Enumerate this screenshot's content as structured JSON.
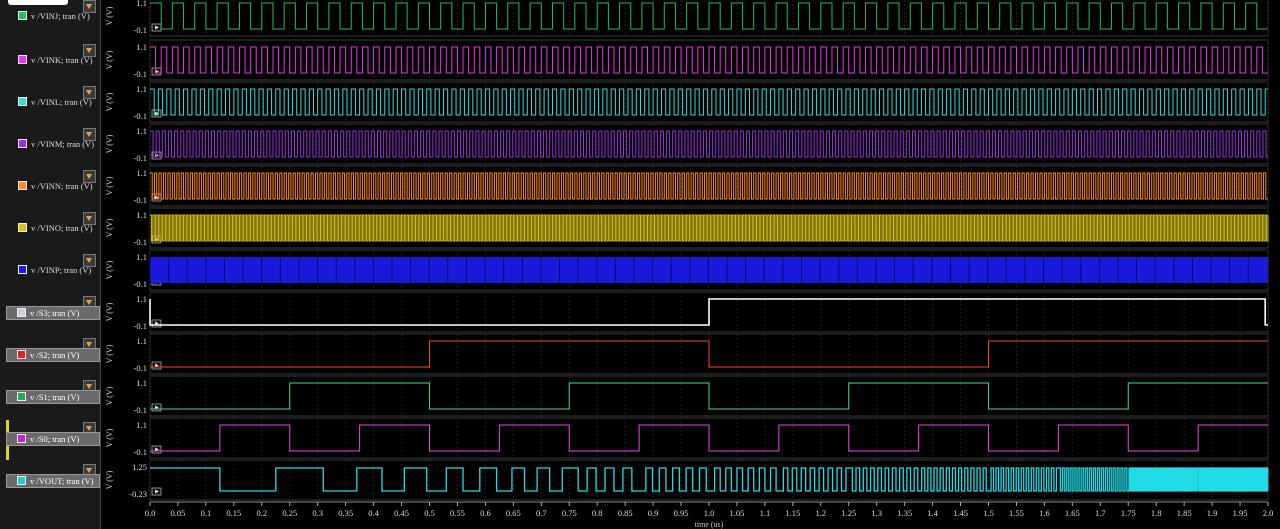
{
  "colors": {
    "background": "#000000",
    "panel": "#1a1a1a",
    "grid": "#2a2a2a"
  },
  "signals": [
    {
      "label": "v /VINJ; tran (V)",
      "color": "#1fbe5a",
      "boxed": false,
      "kind": "clock",
      "period": 0.04
    },
    {
      "label": "v /VINK; tran (V)",
      "color": "#ee33ee",
      "boxed": false,
      "kind": "clock",
      "period": 0.02
    },
    {
      "label": "v /VINL; tran (V)",
      "color": "#33dddd",
      "boxed": false,
      "kind": "clock",
      "period": 0.015
    },
    {
      "label": "v /VINM; tran (V)",
      "color": "#9a33dd",
      "boxed": false,
      "kind": "clock",
      "period": 0.011
    },
    {
      "label": "v /VINN; tran (V)",
      "color": "#ff8a1f",
      "boxed": false,
      "kind": "clock",
      "period": 0.008
    },
    {
      "label": "v /VINO; tran (V)",
      "color": "#d6c21a",
      "boxed": false,
      "kind": "clock",
      "period": 0.005
    },
    {
      "label": "v /VINP; tran (V)",
      "color": "#1a1adb",
      "boxed": false,
      "kind": "dense",
      "period": 0.002
    },
    {
      "label": "v /S3; tran (V)",
      "color": "#ffffff",
      "boxed": true,
      "swatch": "#c8d0e0",
      "kind": "step",
      "steps": [
        [
          0,
          0
        ],
        [
          0.005,
          0
        ],
        [
          1.0,
          1
        ],
        [
          1.99,
          1
        ],
        [
          1.995,
          0
        ]
      ]
    },
    {
      "label": "v /S2; tran (V)",
      "color": "#ff4422",
      "boxed": true,
      "swatch": "#dd2222",
      "kind": "clock",
      "period": 1.0,
      "phase": 0.5
    },
    {
      "label": "v /S1; tran (V)",
      "color": "#44dd77",
      "boxed": true,
      "swatch": "#22aa55",
      "kind": "clock",
      "period": 0.5,
      "phase": 0.25
    },
    {
      "label": "v /S0; tran (V)",
      "color": "#ee44ee",
      "boxed": true,
      "swatch": "#cc22cc",
      "kind": "clock",
      "period": 0.25,
      "phase": 0.125
    },
    {
      "label": "v /VOUT; tran (V)",
      "color": "#22dde8",
      "boxed": true,
      "swatch": "#22cccc",
      "kind": "vout"
    }
  ],
  "chart_data": {
    "type": "line",
    "xlabel": "time (us)",
    "ylabel": "V (V)",
    "xlim": [
      0.0,
      2.0
    ],
    "x_ticks": [
      "0.0",
      "0.05",
      "0.1",
      "0.15",
      "0.2",
      "0.25",
      "0.3",
      "0.35",
      "0.4",
      "0.45",
      "0.5",
      "0.55",
      "0.6",
      "0.65",
      "0.7",
      "0.75",
      "0.8",
      "0.85",
      "0.9",
      "0.95",
      "1.0",
      "1.05",
      "1.1",
      "1.15",
      "1.2",
      "1.25",
      "1.3",
      "1.35",
      "1.4",
      "1.45",
      "1.5",
      "1.55",
      "1.6",
      "1.65",
      "1.7",
      "1.75",
      "1.8",
      "1.85",
      "1.9",
      "1.95",
      "2.0"
    ],
    "y_tick_labels": [
      [
        "1.1",
        "-0.1"
      ],
      [
        "1.1",
        "-0.1"
      ],
      [
        "1.1",
        "-0.1"
      ],
      [
        "1.1",
        "-0.1"
      ],
      [
        "1.1",
        "-0.1"
      ],
      [
        "1.1",
        "-0.1"
      ],
      [
        "1.1",
        "-0.1"
      ],
      [
        "1.1",
        "-0.1"
      ],
      [
        "1.1",
        "-0.1"
      ],
      [
        "1.1",
        "-0.1"
      ],
      [
        "1.1",
        "-0.1"
      ],
      [
        "1.25",
        "-0.23"
      ]
    ],
    "series": [
      {
        "name": "v /VINJ; tran (V)",
        "waveform": "square",
        "low": 0,
        "high": 1
      },
      {
        "name": "v /VINK; tran (V)",
        "waveform": "square",
        "low": 0,
        "high": 1
      },
      {
        "name": "v /VINL; tran (V)",
        "waveform": "square",
        "low": 0,
        "high": 1
      },
      {
        "name": "v /VINM; tran (V)",
        "waveform": "square",
        "low": 0,
        "high": 1
      },
      {
        "name": "v /VINN; tran (V)",
        "waveform": "square",
        "low": 0,
        "high": 1
      },
      {
        "name": "v /VINO; tran (V)",
        "waveform": "square",
        "low": 0,
        "high": 1
      },
      {
        "name": "v /VINP; tran (V)",
        "waveform": "square",
        "low": 0,
        "high": 1
      },
      {
        "name": "v /S3; tran (V)",
        "x": [
          0,
          1.0,
          1.0,
          1.995,
          1.995
        ],
        "y": [
          0,
          0,
          1,
          1,
          0
        ]
      },
      {
        "name": "v /S2; tran (V)",
        "x": [
          0,
          0.5,
          0.5,
          1.0,
          1.0,
          1.5,
          1.5,
          2.0
        ],
        "y": [
          0,
          0,
          1,
          1,
          0,
          0,
          1,
          1
        ]
      },
      {
        "name": "v /S1; tran (V)",
        "x": [
          0,
          0.25,
          0.25,
          0.5,
          0.5,
          0.75,
          0.75,
          1.0,
          1.0,
          1.25,
          1.25,
          1.5,
          1.5,
          1.75,
          1.75,
          2.0
        ],
        "y": [
          0,
          0,
          1,
          1,
          0,
          0,
          1,
          1,
          0,
          0,
          1,
          1,
          0,
          0,
          1,
          1
        ]
      },
      {
        "name": "v /S0; tran (V)",
        "waveform": "square",
        "period": 0.25,
        "low": 0,
        "high": 1
      },
      {
        "name": "v /VOUT; tran (V)",
        "waveform": "mux output",
        "low": 0,
        "high": 1.1
      }
    ],
    "grid": true
  }
}
